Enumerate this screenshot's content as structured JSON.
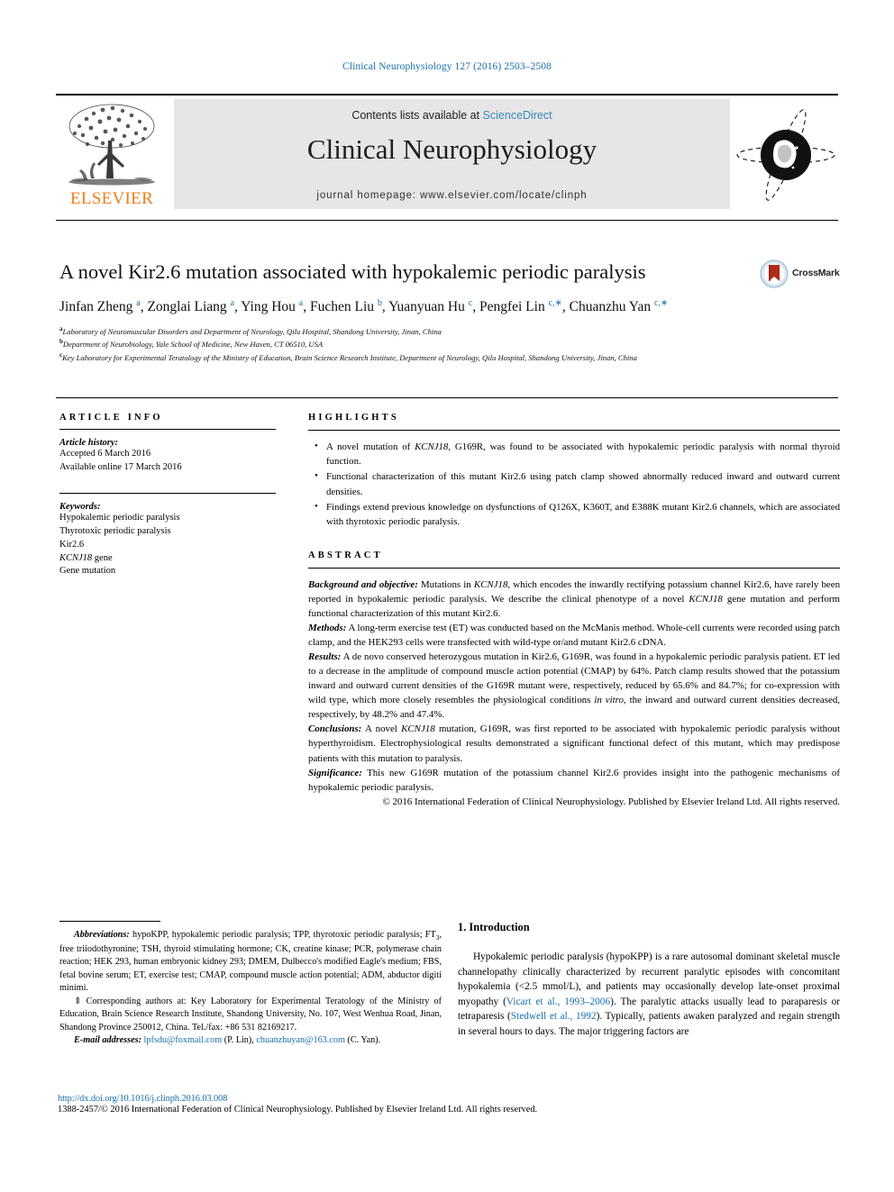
{
  "masthead": {
    "journal_ref": "Clinical Neurophysiology 127 (2016) 2503–2508",
    "contents_prefix": "Contents lists available at ",
    "contents_link": "ScienceDirect",
    "journal_name": "Clinical Neurophysiology",
    "homepage": "journal homepage: www.elsevier.com/locate/clinph",
    "publisher": "ELSEVIER"
  },
  "article": {
    "title": "A novel Kir2.6 mutation associated with hypokalemic periodic paralysis",
    "crossmark_label": "CrossMark",
    "authors_html": "Jinfan Zheng <sup>a</sup>, Zonglai Liang <sup>a</sup>, Ying Hou <sup>a</sup>, Fuchen Liu <sup>b</sup>, Yuanyuan Hu <sup>c</sup>, Pengfei Lin <sup>c,∗</sup>, Chuanzhu Yan <sup>c,∗</sup>",
    "affiliations": [
      {
        "marker": "a",
        "text": "Laboratory of Neuromuscular Disorders and Department of Neurology, Qilu Hospital, Shandong University, Jinan, China"
      },
      {
        "marker": "b",
        "text": "Department of Neurobiology, Yale School of Medicine, New Haven, CT 06510, USA"
      },
      {
        "marker": "c",
        "text": "Key Laboratory for Experimental Teratology of the Ministry of Education, Brain Science Research Institute, Department of Neurology, Qilu Hospital, Shandong University, Jinan, China"
      }
    ]
  },
  "article_info": {
    "heading": "ARTICLE INFO",
    "history_label": "Article history:",
    "history": [
      "Accepted 6 March 2016",
      "Available online 17 March 2016"
    ],
    "keywords_label": "Keywords:",
    "keywords": [
      {
        "text": "Hypokalemic periodic paralysis",
        "italic_part": ""
      },
      {
        "text": "Thyrotoxic periodic paralysis",
        "italic_part": ""
      },
      {
        "text": "Kir2.6",
        "italic_part": ""
      },
      {
        "text": "KCNJ18 gene",
        "italic_part": "KCNJ18"
      },
      {
        "text": "Gene mutation",
        "italic_part": ""
      }
    ]
  },
  "highlights": {
    "heading": "HIGHLIGHTS",
    "items": [
      "A novel mutation of KCNJ18, G169R, was found to be associated with hypokalemic periodic paralysis with normal thyroid function.",
      "Functional characterization of this mutant Kir2.6 using patch clamp showed abnormally reduced inward and outward current densities.",
      "Findings extend previous knowledge on dysfunctions of Q126X, K360T, and E388K mutant Kir2.6 channels, which are associated with thyrotoxic periodic paralysis."
    ]
  },
  "abstract": {
    "heading": "ABSTRACT",
    "sections": [
      {
        "label": "Background and objective:",
        "text": " Mutations in KCNJ18, which encodes the inwardly rectifying potassium channel Kir2.6, have rarely been reported in hypokalemic periodic paralysis. We describe the clinical phenotype of a novel KCNJ18 gene mutation and perform functional characterization of this mutant Kir2.6."
      },
      {
        "label": "Methods:",
        "text": " A long-term exercise test (ET) was conducted based on the McManis method. Whole-cell currents were recorded using patch clamp, and the HEK293 cells were transfected with wild-type or/and mutant Kir2.6 cDNA."
      },
      {
        "label": "Results:",
        "text": " A de novo conserved heterozygous mutation in Kir2.6, G169R, was found in a hypokalemic periodic paralysis patient. ET led to a decrease in the amplitude of compound muscle action potential (CMAP) by 64%. Patch clamp results showed that the potassium inward and outward current densities of the G169R mutant were, respectively, reduced by 65.6% and 84.7%; for co-expression with wild type, which more closely resembles the physiological conditions in vitro, the inward and outward current densities decreased, respectively, by 48.2% and 47.4%."
      },
      {
        "label": "Conclusions:",
        "text": " A novel KCNJ18 mutation, G169R, was first reported to be associated with hypokalemic periodic paralysis without hyperthyroidism. Electrophysiological results demonstrated a significant functional defect of this mutant, which may predispose patients with this mutation to paralysis."
      },
      {
        "label": "Significance:",
        "text": " This new G169R mutation of the potassium channel Kir2.6 provides insight into the pathogenic mechanisms of hypokalemic periodic paralysis."
      }
    ],
    "copyright": "© 2016 International Federation of Clinical Neurophysiology. Published by Elsevier Ireland Ltd. All rights reserved."
  },
  "footnotes": {
    "abbrev_label": "Abbreviations:",
    "abbrev_text": " hypoKPP, hypokalemic periodic paralysis; TPP, thyrotoxic periodic paralysis; FT3, free triiodothyronine; TSH, thyroid stimulating hormone; CK, creatine kinase; PCR, polymerase chain reaction; HEK 293, human embryonic kidney 293; DMEM, Dulbecco's modified Eagle's medium; FBS, fetal bovine serum; ET, exercise test; CMAP, compound muscle action potential; ADM, abductor digiti minimi.",
    "corresponding_marker": "⇑",
    "corresponding_text": " Corresponding authors at: Key Laboratory for Experimental Teratology of the Ministry of Education, Brain Science Research Institute, Shandong University, No. 107, West Wenhua Road, Jinan, Shandong Province 250012, China. Tel./fax: +86 531 82169217.",
    "email_label": "E-mail addresses:",
    "email_1": "lpfsdu@foxmail.com",
    "email_1_owner": " (P. Lin), ",
    "email_2": "chuanzhuyan@163.com",
    "email_2_owner": " (C. Yan)."
  },
  "doi_block": {
    "doi": "http://dx.doi.org/10.1016/j.clinph.2016.03.008",
    "issn_line": "1388-2457/© 2016 International Federation of Clinical Neurophysiology. Published by Elsevier Ireland Ltd. All rights reserved."
  },
  "introduction": {
    "heading": "1. Introduction",
    "paragraph_part1": "Hypokalemic periodic paralysis (hypoKPP) is a rare autosomal dominant skeletal muscle channelopathy clinically characterized by recurrent paralytic episodes with concomitant hypokalemia (<2.5 mmol/L), and patients may occasionally develop late-onset proximal myopathy (",
    "citation_1": "Vicart et al., 1993–2006",
    "paragraph_part2": "). The paralytic attacks usually lead to paraparesis or tetraparesis (",
    "citation_2": "Stedwell et al., 1992",
    "paragraph_part3": "). Typically, patients awaken paralyzed and regain strength in several hours to days. The major triggering factors are"
  },
  "colors": {
    "link_blue": "#1a6ea8",
    "elsevier_orange": "#ef7d1a",
    "band_grey": "#e6e6e6"
  }
}
